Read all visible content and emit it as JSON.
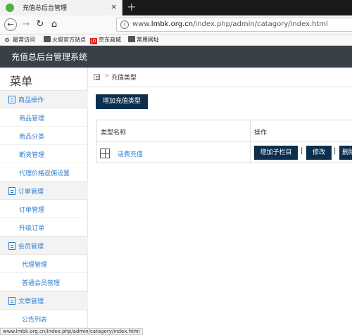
{
  "browser": {
    "tab_title": "充值总后台管理",
    "tab_close": "×",
    "new_tab": "+",
    "url_prefix": "www.",
    "url_host": "lmbk.org.cn",
    "url_path": "/index.php/admin/catagory/index.html",
    "bookmarks": [
      "最常访问",
      "火狐官方站点",
      "京东商城",
      "常用网址"
    ],
    "jd_glyph": "JD",
    "status_url": "www.lmbk.org.cn/index.php/admin/catagory/index.html"
  },
  "header": {
    "title": "充值总后台管理系统"
  },
  "sidebar": {
    "title": "菜单",
    "sections": [
      {
        "label": "商品操作",
        "items": [
          "商品管理",
          "商品分类",
          "断货管理",
          "代理价格返佣设置"
        ]
      },
      {
        "label": "订单管理",
        "items": [
          "订单管理",
          "升级订单"
        ]
      },
      {
        "label": "会员管理",
        "items": [
          "代理管理",
          "普通会员管理"
        ]
      },
      {
        "label": "文章管理",
        "items": [
          "公告列表"
        ]
      }
    ]
  },
  "breadcrumb": {
    "separator": ">",
    "current": "充值类型"
  },
  "main": {
    "add_button": "增加充值类型",
    "table": {
      "headers": [
        "类型名称",
        "操作"
      ],
      "rows": [
        {
          "name": "话费充值",
          "actions": [
            "增加子栏目",
            "修改",
            "删除"
          ]
        }
      ],
      "action_separator": "|"
    }
  },
  "colors": {
    "header_bg": "#3a4048",
    "button_bg": "#0d2f4f",
    "link": "#2f7fd0"
  }
}
